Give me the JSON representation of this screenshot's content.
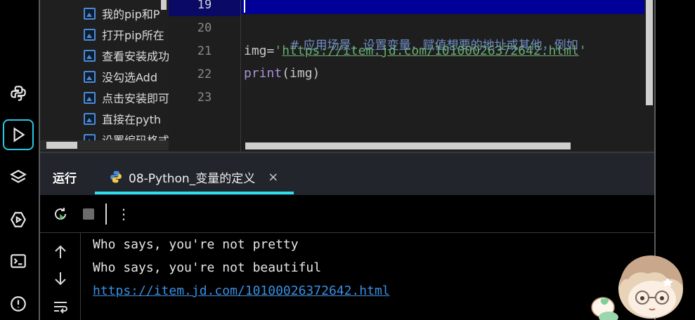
{
  "file_tree": {
    "items": [
      {
        "label": "我的pip和P"
      },
      {
        "label": "打开pip所在"
      },
      {
        "label": "查看安装成功"
      },
      {
        "label": "没勾选Add"
      },
      {
        "label": "点击安装即可"
      },
      {
        "label": "直接在pyth"
      },
      {
        "label": "设置编码格式"
      }
    ]
  },
  "editor": {
    "line_numbers": [
      "19",
      "20",
      "21",
      "22",
      "23"
    ],
    "current_line": "19",
    "lines": {
      "l20_comment": "# 应用场景，设置变量，赋值想要的地址或其他，例如",
      "l21_var": "img=",
      "l21_quote_open": "'",
      "l21_url": "https://item.jd.com/10100026372642.html",
      "l21_quote_close": "'",
      "l22_func": "print",
      "l22_args": "(img)"
    }
  },
  "run_panel": {
    "title": "运行",
    "tab_label": "08-Python_变量的定义",
    "tab_close": "×",
    "output": [
      "Who says, you're not pretty",
      "Who says, you're not beautiful"
    ],
    "output_link": "https://item.jd.com/10100026372642.html"
  },
  "toolbar": {
    "more_label": "⋮"
  },
  "icons": {
    "activity": [
      "python-icon",
      "run-icon",
      "layers-icon",
      "services-icon",
      "terminal-icon",
      "problems-icon"
    ],
    "console": [
      "arrow-up-icon",
      "arrow-down-icon",
      "soft-wrap-icon"
    ]
  },
  "colors": {
    "accent": "#2ee0ef",
    "link": "#3a8fe0",
    "string": "#6aab73",
    "comment": "#6f8fc7",
    "current_line_bg": "#000099"
  }
}
